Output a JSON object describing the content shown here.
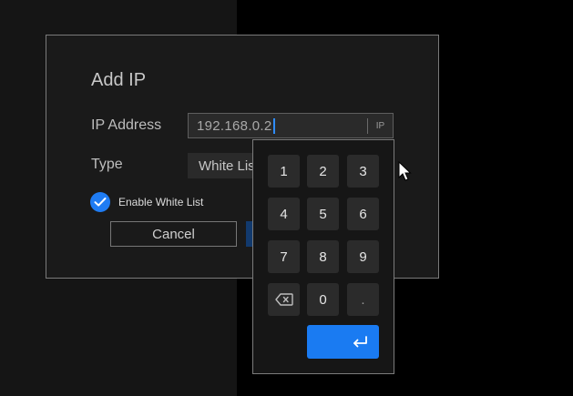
{
  "dialog": {
    "title": "Add IP",
    "ip_label": "IP Address",
    "ip_value": "192.168.0.2",
    "ip_tag": "IP",
    "type_label": "Type",
    "type_value": "White List",
    "enable_label": "Enable White List",
    "enable_checked": true,
    "cancel_label": "Cancel"
  },
  "keypad": {
    "keys": [
      "1",
      "2",
      "3",
      "4",
      "5",
      "6",
      "7",
      "8",
      "9",
      "0",
      "."
    ],
    "backspace_icon": "backspace-icon",
    "enter_icon": "enter-icon"
  },
  "colors": {
    "accent": "#1a7bf2",
    "caret": "#2f8cff"
  }
}
